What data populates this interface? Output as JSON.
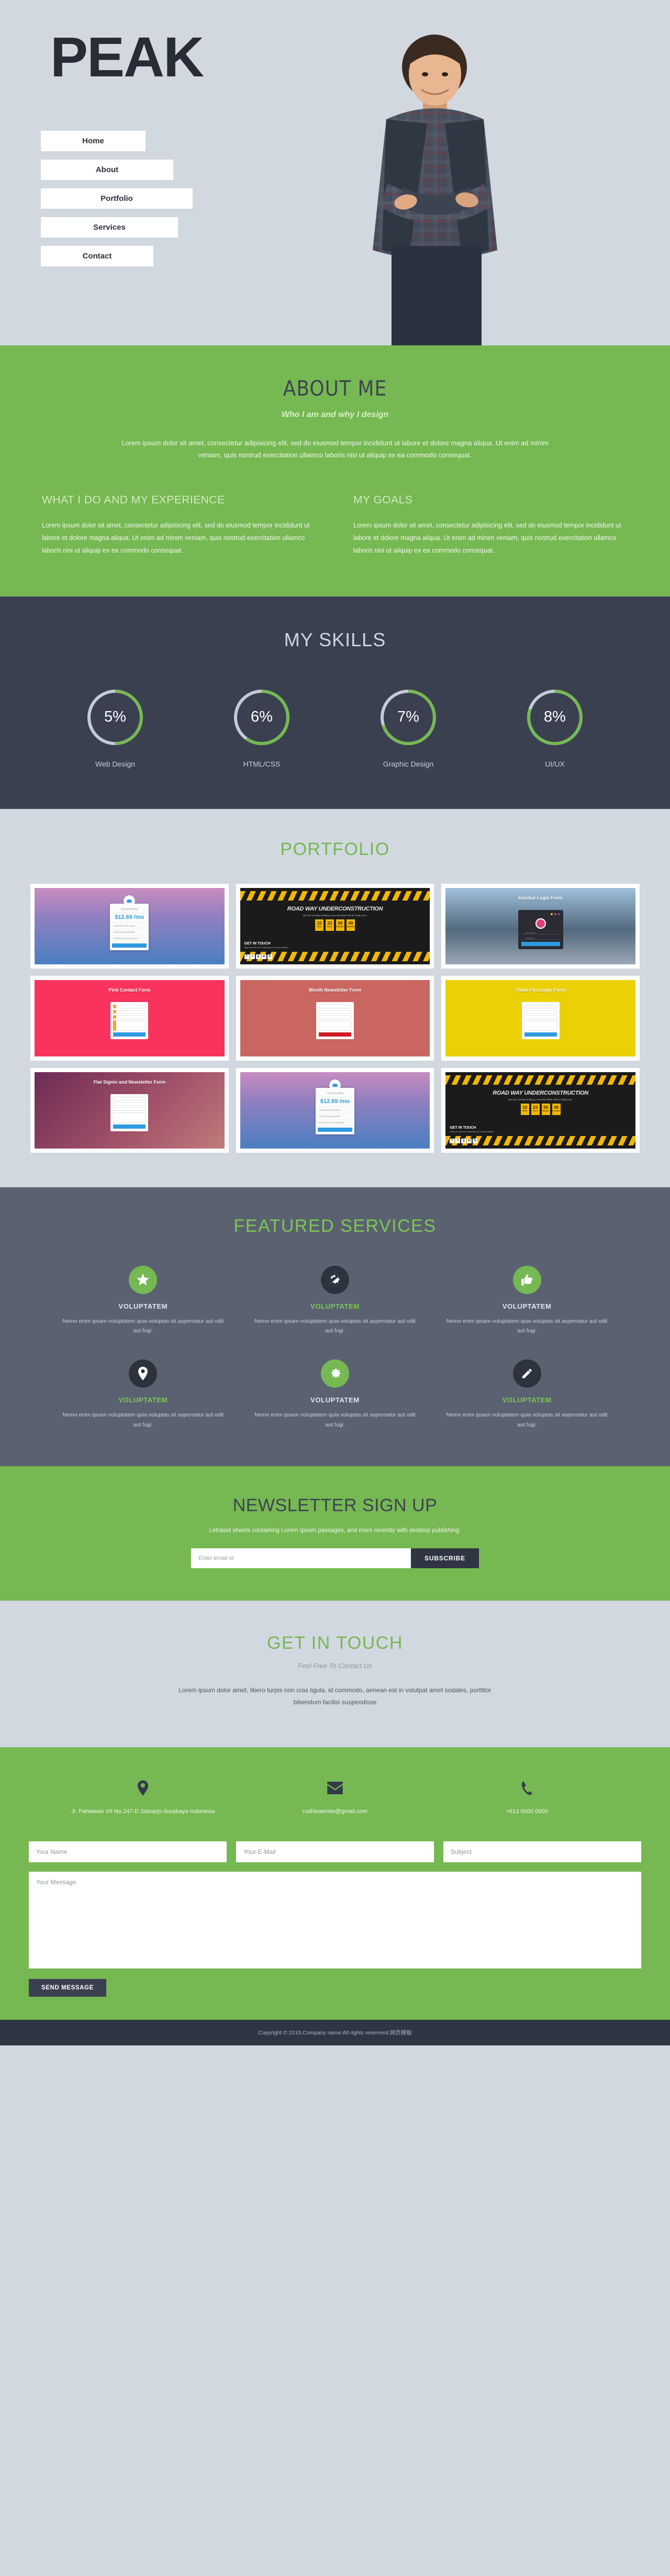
{
  "hero": {
    "logo": "PEAK",
    "nav": [
      {
        "label": "Home"
      },
      {
        "label": "About"
      },
      {
        "label": "Portfolio"
      },
      {
        "label": "Services"
      },
      {
        "label": "Contact"
      }
    ]
  },
  "about": {
    "title": "ABOUT ME",
    "tagline": "Who I am and why I design",
    "intro": "Lorem ipsum dolor sit amet, consectetur adipisicing elit, sed do eiusmod tempor incididunt ut labore et dolore magna aliqua. Ut enim ad minim veniam, quis nostrud exercitation ullamco laboris nisi ut aliquip ex ea commodo consequat.",
    "columns": [
      {
        "heading": "WHAT I DO AND MY EXPERIENCE",
        "body": "Lorem ipsum dolor sit amet, consectetur adipisicing elit, sed do eiusmod tempor incididunt ut labore et dolore magna aliqua. Ut enim ad minim veniam, quis nostrud exercitation ullamco laboris nisi ut aliquip ex ea commodo consequat."
      },
      {
        "heading": "MY GOALS",
        "body": "Lorem ipsum dolor sit amet, consectetur adipisicing elit, sed do eiusmod tempor incididunt ut labore et dolore magna aliqua. Ut enim ad minim veniam, quis nostrud exercitation ullamco laboris nisi ut aliquip ex ea commodo consequat."
      }
    ]
  },
  "skills": {
    "title": "MY SKILLS",
    "items": [
      {
        "label": "Web Design",
        "value": "5%",
        "percent": 50
      },
      {
        "label": "HTML/CSS",
        "value": "6%",
        "percent": 60
      },
      {
        "label": "Graphic Design",
        "value": "7%",
        "percent": 70
      },
      {
        "label": "UI/UX",
        "value": "8%",
        "percent": 80
      }
    ]
  },
  "portfolio": {
    "title": "PORTFOLIO",
    "items": [
      {
        "caption": "Cloud Hosting",
        "style": "t-cloud"
      },
      {
        "caption": "ROAD WAY UNDERCONSTRUCTION",
        "style": "t-road"
      },
      {
        "caption": "klasikal Login Form",
        "style": "t-klas"
      },
      {
        "caption": "Pink Contact Form",
        "style": "t-pink"
      },
      {
        "caption": "Month Newsletter Form",
        "style": "t-news"
      },
      {
        "caption": "Clean Flat Login Form",
        "style": "t-yellow"
      },
      {
        "caption": "Flat Signin and Newsletter Form",
        "style": "t-flat"
      },
      {
        "caption": "Cloud Hosting",
        "style": "t-cloud"
      },
      {
        "caption": "ROAD WAY UNDERCONSTRUCTION",
        "style": "t-road"
      }
    ],
    "cloud_card": {
      "title": "Cloud Hosting",
      "price": "$12.69 /mo",
      "features": [
        "Unlimited Disk space",
        "Unlimited Bandwidth",
        "Unlimited Email address"
      ]
    },
    "road_card": {
      "title": "ROAD WAY UNDERCONSTRUCTION",
      "subtitle": "We are currently building a new site which will be ready soon.",
      "countdown": [
        {
          "num": "10",
          "unit": "DAYS"
        },
        {
          "num": "23",
          "unit": "Hours"
        },
        {
          "num": "59",
          "unit": "Minutes"
        },
        {
          "num": "49",
          "unit": "Seconds"
        }
      ],
      "get_in_touch": "GET IN TOUCH",
      "get_in_touch_sub": "Stay tuned and don't forget Sign up for latest Updates!"
    }
  },
  "services": {
    "title": "FEATURED SERVICES",
    "items": [
      {
        "icon": "star-icon",
        "icon_style": "green",
        "label": "VOLUPTATEM",
        "label_style": "white",
        "body": "Nemo enim ipsam voluptatem quia voluptas sit aspernatur aut odit aut fugi."
      },
      {
        "icon": "globe-icon",
        "icon_style": "dark",
        "label": "VOLUPTATEM",
        "label_style": "green",
        "body": "Nemo enim ipsam voluptatem quia voluptas sit aspernatur aut odit aut fugi."
      },
      {
        "icon": "thumbs-up-icon",
        "icon_style": "green",
        "label": "VOLUPTATEM",
        "label_style": "white",
        "body": "Nemo enim ipsam voluptatem quia voluptas sit aspernatur aut odit aut fugi."
      },
      {
        "icon": "map-pin-icon",
        "icon_style": "dark",
        "label": "VOLUPTATEM",
        "label_style": "green",
        "body": "Nemo enim ipsam voluptatem quia voluptas sit aspernatur aut odit aut fugi."
      },
      {
        "icon": "gear-icon",
        "icon_style": "green",
        "label": "VOLUPTATEM",
        "label_style": "white",
        "body": "Nemo enim ipsam voluptatem quia voluptas sit aspernatur aut odit aut fugi."
      },
      {
        "icon": "pencil-icon",
        "icon_style": "dark",
        "label": "VOLUPTATEM",
        "label_style": "green",
        "body": "Nemo enim ipsam voluptatem quia voluptas sit aspernatur aut odit aut fugi."
      }
    ]
  },
  "newsletter": {
    "title": "NEWSLETTER SIGN UP",
    "subtitle": "Letraset sheets containing Lorem Ipsum passages, and more recently with desktop publishing.",
    "placeholder": "Enter email id",
    "button": "SUBSCRIBE"
  },
  "touch": {
    "title": "GET IN TOUCH",
    "subtitle": "Feel Free To Contact Us",
    "blurb": "Lorem ipsum dolor amet, libero turpis non cras ligula, id commodo, aenean est in volutpat amet sodales, porttitor bibendum facilisi suspendisse"
  },
  "contact": {
    "details": [
      {
        "icon": "map-pin-icon",
        "text": "Jl. Pahlawan VII No.247-D Sidoarjo-Surabaya-Indonesia"
      },
      {
        "icon": "mail-icon",
        "text": "rudhisasmito@gmail.com"
      },
      {
        "icon": "phone-icon",
        "text": "+613 0000 0000"
      }
    ],
    "form": {
      "name_placeholder": "Your Name",
      "email_placeholder": "Your E-Mail",
      "subject_placeholder": "Subject",
      "message_placeholder": "Your Message",
      "submit": "SEND MESSAGE"
    }
  },
  "footer": {
    "copyright": "Copyright © 2015.Company name All rights reserverd.网页模板"
  },
  "colors": {
    "green": "#76b852",
    "light_green": "#7ec654",
    "dark_navy": "#282c37",
    "slate": "#3a4050",
    "gray_blue": "#5a6271",
    "page_bg": "#d2d8e0",
    "footer_bg": "#2f3542"
  }
}
